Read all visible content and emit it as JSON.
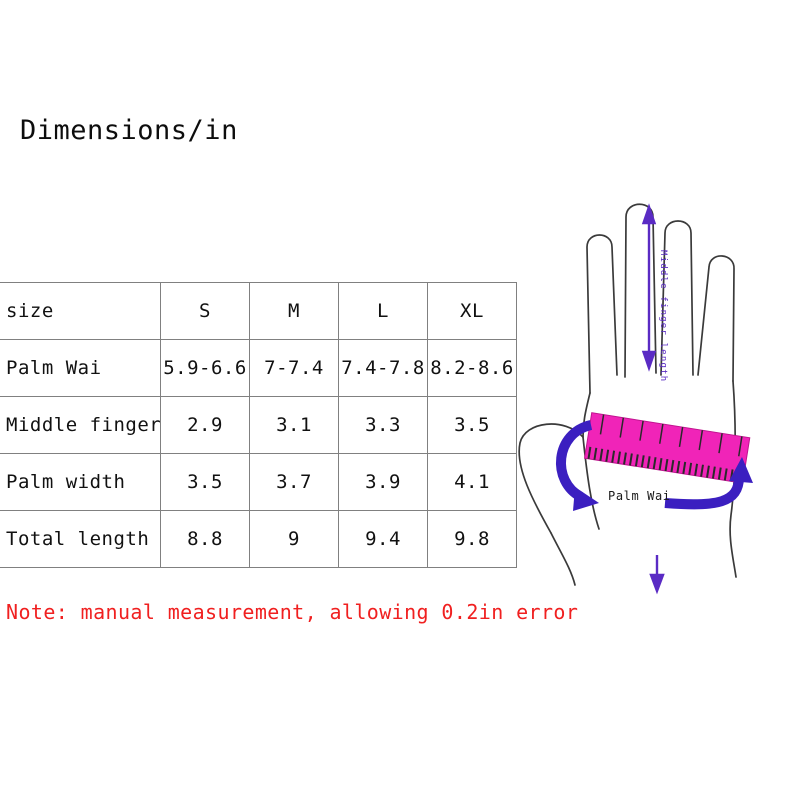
{
  "title": "Dimensions/in",
  "table": {
    "header": [
      "size",
      "S",
      "M",
      "L",
      "XL"
    ],
    "rows": [
      {
        "label": "Palm Wai",
        "values": [
          "5.9-6.6",
          "7-7.4",
          "7.4-7.8",
          "8.2-8.6"
        ]
      },
      {
        "label": "Middle finger",
        "values": [
          "2.9",
          "3.1",
          "3.3",
          "3.5"
        ]
      },
      {
        "label": "Palm width",
        "values": [
          "3.5",
          "3.7",
          "3.9",
          "4.1"
        ]
      },
      {
        "label": "Total length",
        "values": [
          "8.8",
          "9",
          "9.4",
          "9.8"
        ]
      }
    ]
  },
  "note": "Note: manual measurement, allowing 0.2in error",
  "diagram": {
    "middle_finger_label": "Middle finger length",
    "palm_wai_label": "Palm Wai",
    "colors": {
      "arrow_purple": "#5a2bc4",
      "arrow_blue": "#3b1fc0",
      "ruler_pink": "#f024b8",
      "hand_outline": "#3a3a3a",
      "note_red": "#f02020"
    }
  }
}
